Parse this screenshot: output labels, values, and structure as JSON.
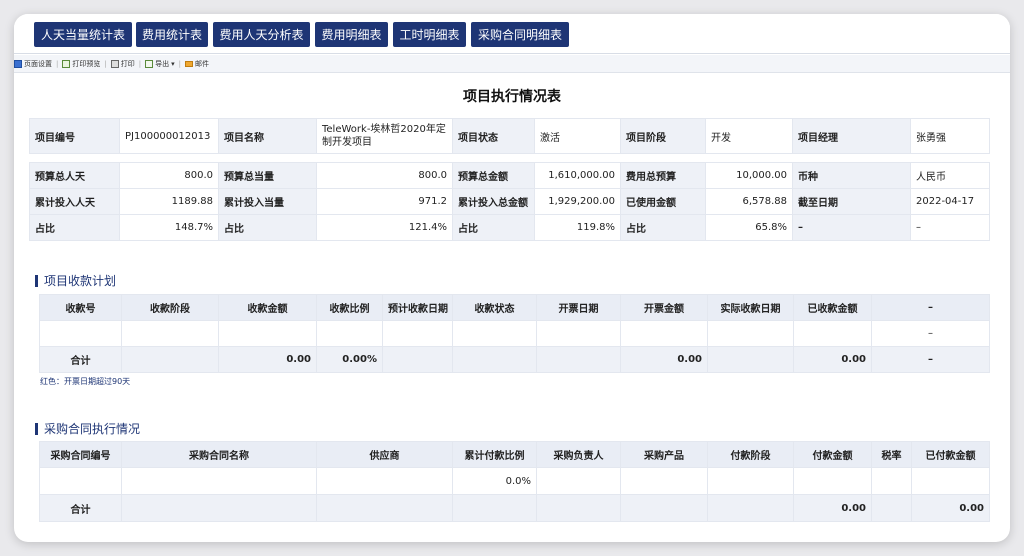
{
  "tabs": [
    "人天当量统计表",
    "费用统计表",
    "费用人天分析表",
    "费用明细表",
    "工时明细表",
    "采购合同明细表"
  ],
  "toolbar": {
    "page_setup": "页面设置",
    "print_preview": "打印预览",
    "print": "打印",
    "export": "导出",
    "mail": "邮件"
  },
  "report_title": "项目执行情况表",
  "info": {
    "project_no_label": "项目编号",
    "project_no": "PJ100000012013",
    "project_name_label": "项目名称",
    "project_name": "TeleWork-埃林哲2020年定制开发项目",
    "status_label": "项目状态",
    "status": "激活",
    "stage_label": "项目阶段",
    "stage": "开发",
    "manager_label": "项目经理",
    "manager": "张勇强"
  },
  "budget": {
    "r1": {
      "l1": "预算总人天",
      "v1": "800.0",
      "l2": "预算总当量",
      "v2": "800.0",
      "l3": "预算总金额",
      "v3": "1,610,000.00",
      "l4": "费用总预算",
      "v4": "10,000.00",
      "l5": "币种",
      "v5": "人民币"
    },
    "r2": {
      "l1": "累计投入人天",
      "v1": "1189.88",
      "l2": "累计投入当量",
      "v2": "971.2",
      "l3": "累计投入总金额",
      "v3": "1,929,200.00",
      "l4": "已使用金额",
      "v4": "6,578.88",
      "l5": "截至日期",
      "v5": "2022-04-17"
    },
    "r3": {
      "l1": "占比",
      "v1": "148.7%",
      "l2": "占比",
      "v2": "121.4%",
      "l3": "占比",
      "v3": "119.8%",
      "l4": "占比",
      "v4": "65.8%",
      "l5": "–",
      "v5": "–"
    }
  },
  "collection": {
    "section_title": "项目收款计划",
    "headers": [
      "收款号",
      "收款阶段",
      "收款金额",
      "收款比例",
      "预计收款日期",
      "收款状态",
      "开票日期",
      "开票金额",
      "实际收款日期",
      "已收款金额",
      "–"
    ],
    "empty_row_last": "–",
    "total_label": "合计",
    "total_amount": "0.00",
    "total_ratio": "0.00%",
    "total_invoice": "0.00",
    "total_received": "0.00",
    "total_last": "–",
    "note": "红色：开票日期超过90天"
  },
  "purchase": {
    "section_title": "采购合同执行情况",
    "headers": [
      "采购合同编号",
      "采购合同名称",
      "供应商",
      "累计付款比例",
      "采购负责人",
      "采购产品",
      "付款阶段",
      "付款金额",
      "税率",
      "已付款金额"
    ],
    "row_ratio": "0.0%",
    "total_label": "合计",
    "total_payment": "0.00",
    "total_paid": "0.00"
  },
  "colors": {
    "primary": "#1e3575",
    "header_bg": "#e9edf5",
    "label_bg": "#eef1f7"
  }
}
